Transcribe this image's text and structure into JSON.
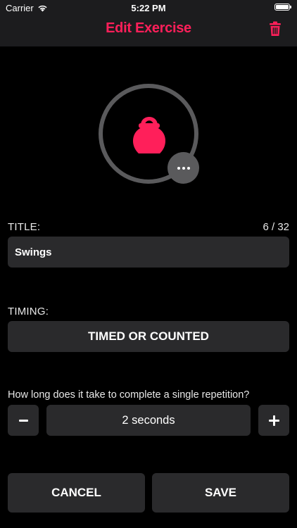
{
  "status_bar": {
    "carrier": "Carrier",
    "time": "5:22 PM",
    "battery_level": 1.0
  },
  "nav": {
    "title": "Edit Exercise",
    "delete_icon": "trash-icon"
  },
  "exercise_icon": {
    "icon": "kettlebell-icon",
    "more_icon": "ellipsis-icon"
  },
  "title_field": {
    "label": "TITLE:",
    "counter": "6 / 32",
    "value": "Swings"
  },
  "timing": {
    "label": "TIMING:",
    "button_label": "TIMED OR COUNTED"
  },
  "repetition": {
    "question": "How long does it take to complete a single repetition?",
    "value": "2 seconds",
    "decrement_icon": "minus-icon",
    "increment_icon": "plus-icon"
  },
  "actions": {
    "cancel_label": "CANCEL",
    "save_label": "SAVE"
  },
  "colors": {
    "accent": "#ff1f5a",
    "background": "#000000",
    "navbar": "#1c1c1e",
    "control": "#2a2a2c",
    "ring": "#5a5a5c"
  }
}
